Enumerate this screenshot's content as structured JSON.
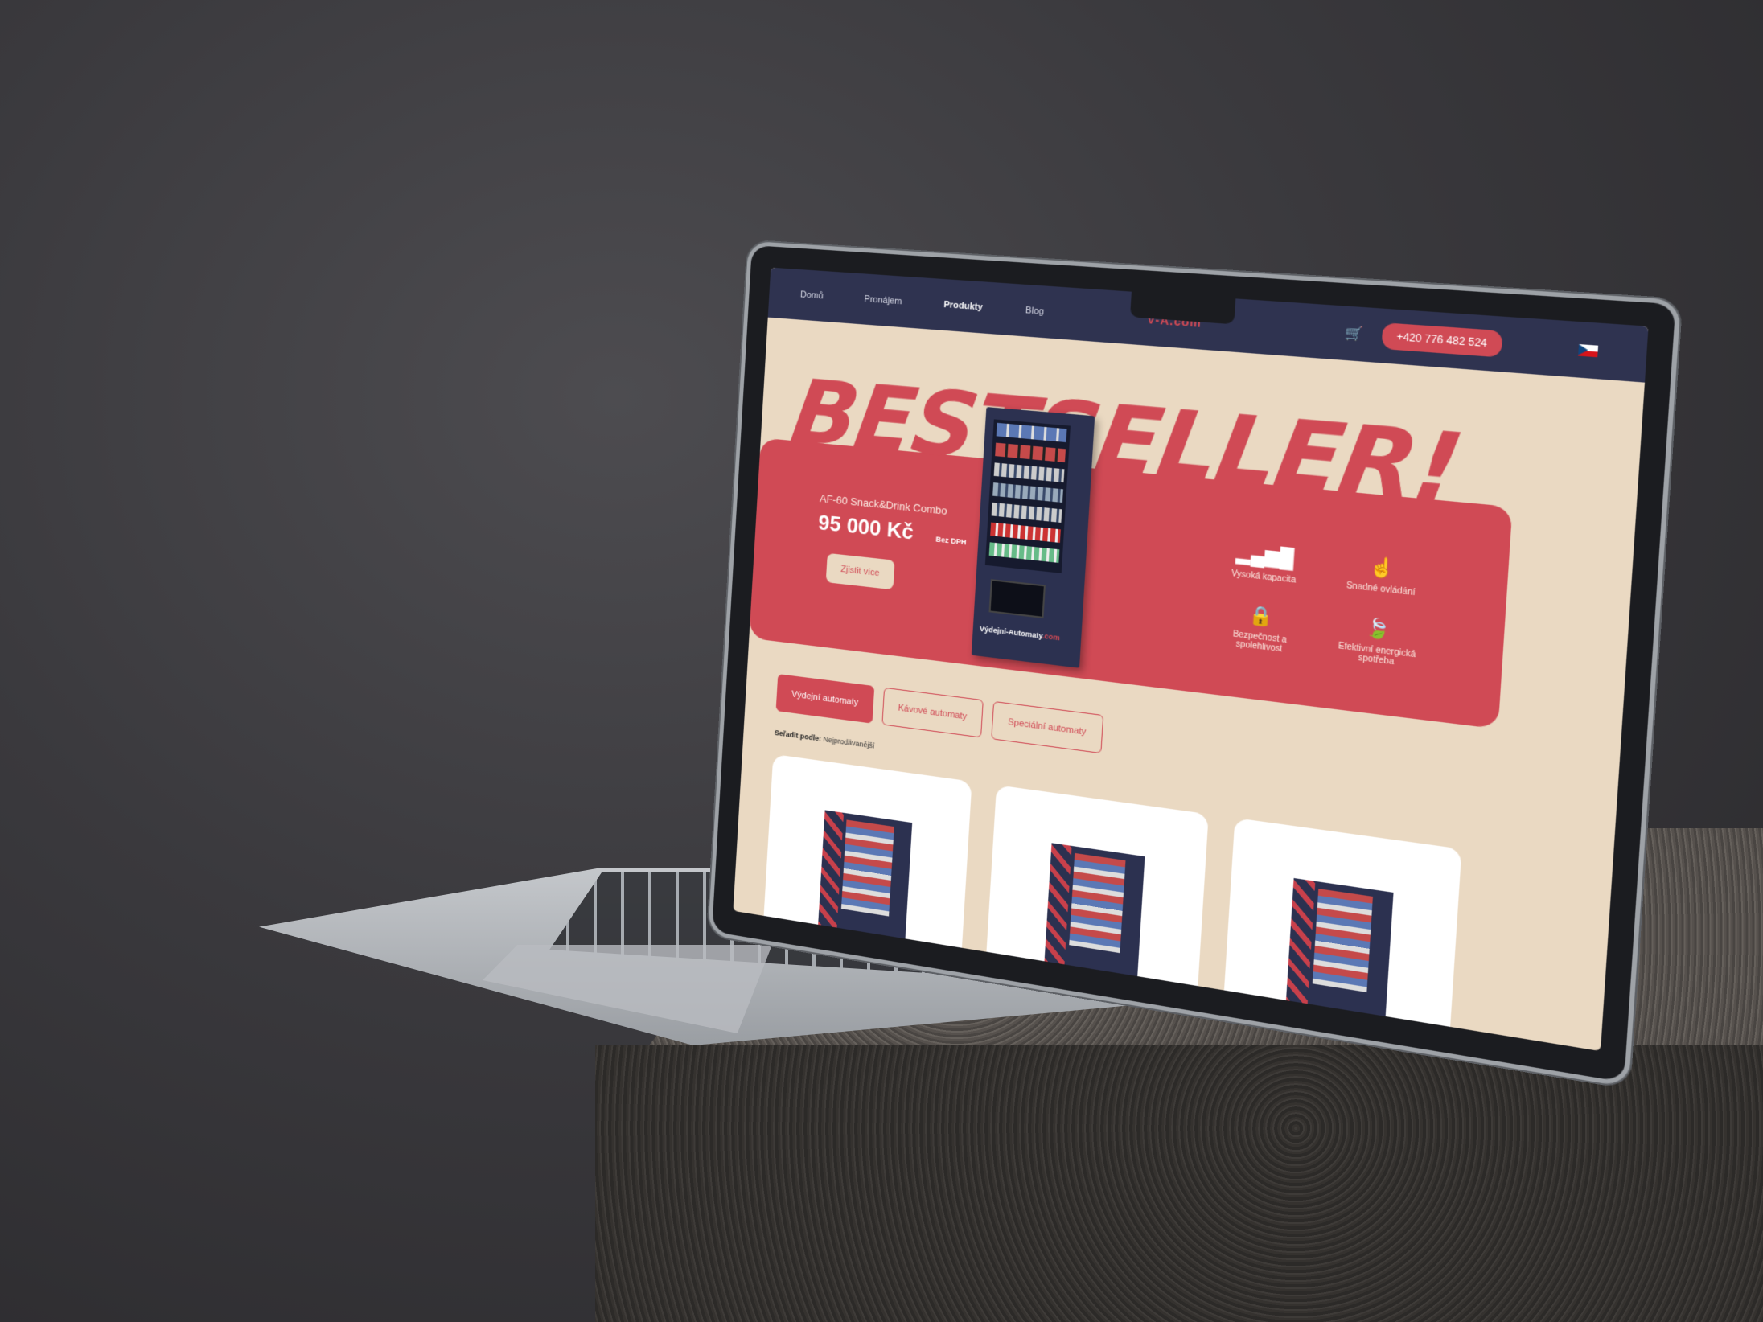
{
  "nav": {
    "items": [
      "Domů",
      "Pronájem",
      "Produkty",
      "Blog"
    ],
    "active": "Produkty",
    "logo": "V-A.com",
    "phone": "+420 776 482 524"
  },
  "hero": {
    "headline": "BESTSELLER!",
    "product_name": "AF-60 Snack&Drink Combo",
    "price": "95 000 Kč",
    "vat_note": "Bez DPH",
    "cta": "Zjistit více",
    "machine_label_a": "Výdejní-Automaty",
    "machine_label_b": ".com",
    "features": [
      {
        "icon": "signal-icon",
        "label": "Vysoká kapacita"
      },
      {
        "icon": "touch-icon",
        "label": "Snadné ovládání"
      },
      {
        "icon": "lock-icon",
        "label": "Bezpečnost a spolehlivost"
      },
      {
        "icon": "leaf-icon",
        "label": "Efektivní energická spotřeba"
      }
    ]
  },
  "tabs": [
    "Výdejní automaty",
    "Kávové automaty",
    "Speciální automaty"
  ],
  "sort": {
    "label": "Seřadit podle:",
    "value": "Nejprodávanější"
  },
  "colors": {
    "accent": "#d04a55",
    "nav": "#2f3350",
    "background": "#ead9c2"
  }
}
